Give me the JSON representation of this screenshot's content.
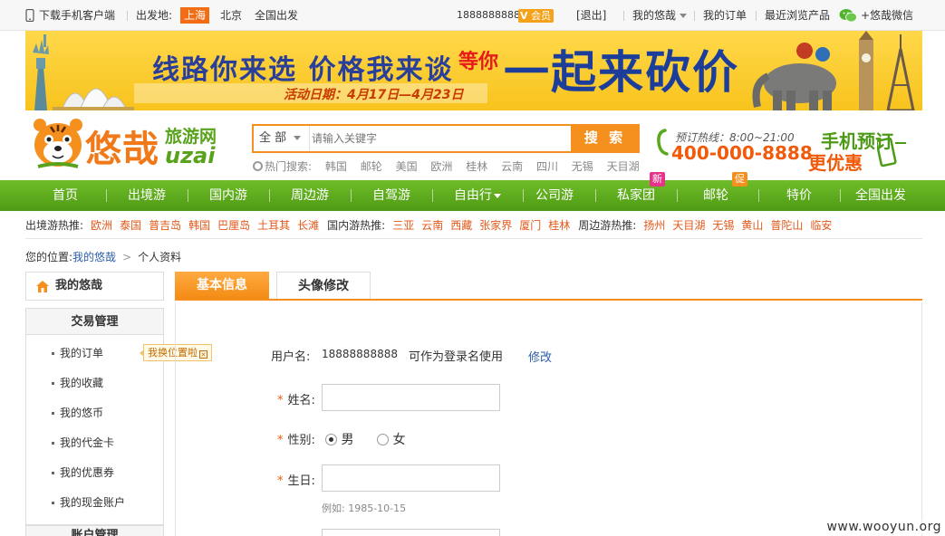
{
  "topbar": {
    "download_app": "下载手机客户端",
    "departure_label": "出发地:",
    "cities": [
      "上海",
      "北京",
      "全国出发"
    ],
    "phone": "18888888888",
    "vip_label": "会员",
    "vip_v": "V",
    "logout": "[退出]",
    "my_uzai": "我的悠哉",
    "my_orders": "我的订单",
    "recent_products": "最近浏览产品",
    "wechat": "+悠哉微信"
  },
  "banner": {
    "slogan": "线路你来选 价格我来谈",
    "tag": "等你",
    "big": "一起来砍价",
    "date": "活动日期：4月17日—4月23日"
  },
  "header": {
    "logo_cn": "悠哉",
    "logo_sub": "旅游网",
    "logo_en": "uzai",
    "search_scope": "全 部",
    "search_placeholder": "请输入关键字",
    "search_button": "搜 索",
    "hot_search_label": "热门搜索:",
    "hot_keywords": [
      "韩国",
      "邮轮",
      "美国",
      "欧洲",
      "桂林",
      "云南",
      "四川",
      "无锡",
      "天目湖"
    ],
    "hotline_label": "预订热线：8:00~21:00",
    "hotline_number": "400-000-8888",
    "mobile_line1": "手机预订",
    "mobile_line2": "更优惠"
  },
  "nav": {
    "items": [
      "首页",
      "出境游",
      "国内游",
      "周边游",
      "自驾游",
      "自由行",
      "公司游",
      "私家团",
      "邮轮",
      "特价",
      "全国出发"
    ],
    "badge_new": "新",
    "badge_promo": "促"
  },
  "hotbar": {
    "groups": [
      {
        "label": "出境游热推:",
        "items": [
          "欧洲",
          "泰国",
          "普吉岛",
          "韩国",
          "巴厘岛",
          "土耳其",
          "长滩"
        ]
      },
      {
        "label": "国内游热推:",
        "items": [
          "三亚",
          "云南",
          "西藏",
          "张家界",
          "厦门",
          "桂林"
        ]
      },
      {
        "label": "周边游热推:",
        "items": [
          "扬州",
          "天目湖",
          "无锡",
          "黄山",
          "普陀山",
          "临安"
        ]
      }
    ]
  },
  "breadcrumb": {
    "prefix": "您的位置:",
    "home": "我的悠哉",
    "current": "个人资料"
  },
  "sidebar": {
    "home": "我的悠哉",
    "group_title": "交易管理",
    "items": [
      "我的订单",
      "我的收藏",
      "我的悠币",
      "我的代金卡",
      "我的优惠券",
      "我的现金账户"
    ],
    "tooltip": "我换位置啦",
    "group2_title": "账户管理"
  },
  "tabs": {
    "basic": "基本信息",
    "avatar": "头像修改"
  },
  "form": {
    "username_label": "用户名:",
    "username_value": "18888888888",
    "username_note": "可作为登录名使用",
    "modify": "修改",
    "name_label": "姓名:",
    "gender_label": "性别:",
    "gender_male": "男",
    "gender_female": "女",
    "birthday_label": "生日:",
    "birthday_hint": "例如: 1985-10-15",
    "required_mark": "*"
  },
  "watermark": "www.wooyun.org",
  "colors": {
    "brand_orange": "#f5901e",
    "nav_green": "#5aa81c",
    "link_blue": "#2c5ea8",
    "hot_orange": "#e2581a"
  }
}
